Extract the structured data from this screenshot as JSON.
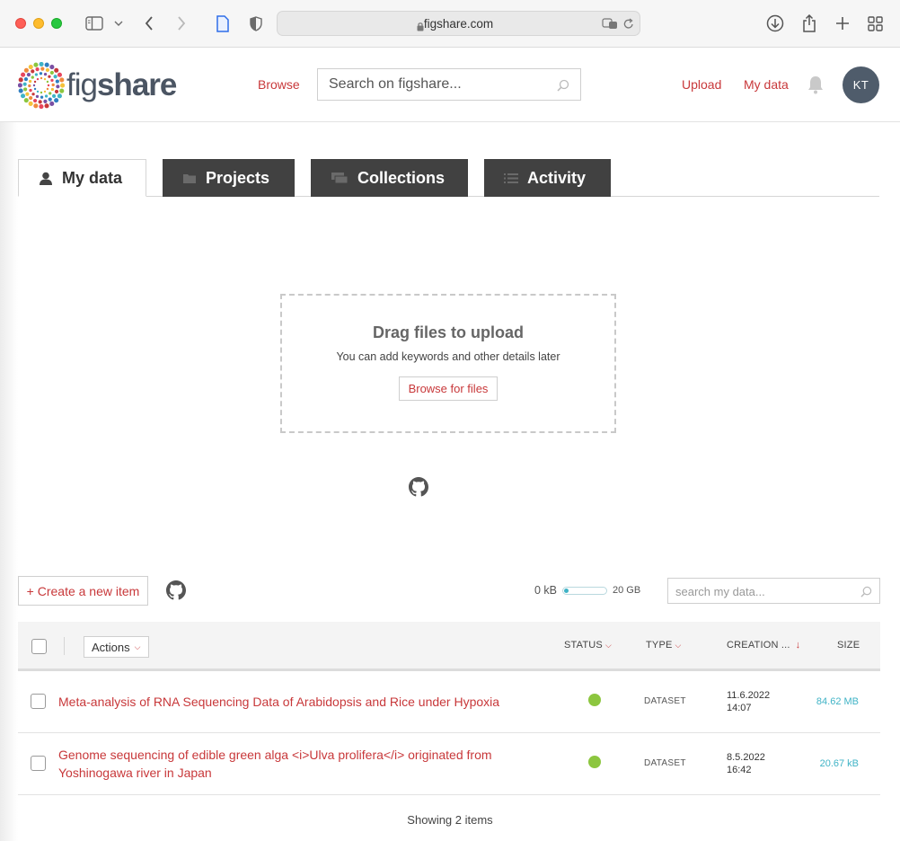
{
  "browser": {
    "url_host": "figshare.com"
  },
  "header": {
    "logo_fig": "fig",
    "logo_share": "share",
    "browse_label": "Browse",
    "search_placeholder": "Search on figshare...",
    "upload_label": "Upload",
    "mydata_label": "My data",
    "avatar_initials": "KT"
  },
  "tabs": [
    {
      "label": "My data",
      "icon": "user-icon",
      "active": true
    },
    {
      "label": "Projects",
      "icon": "folder-icon",
      "active": false
    },
    {
      "label": "Collections",
      "icon": "collections-icon",
      "active": false
    },
    {
      "label": "Activity",
      "icon": "list-icon",
      "active": false
    }
  ],
  "dropzone": {
    "title": "Drag files to upload",
    "subtitle": "You can add keywords and other details later",
    "button_label": "Browse for files"
  },
  "toolbar": {
    "create_label": "+ Create a new item",
    "storage_used": "0 kB",
    "storage_total": "20 GB",
    "storage_fraction": 0.0,
    "search_placeholder": "search my data..."
  },
  "table": {
    "actions_label": "Actions",
    "columns": {
      "status": "STATUS",
      "type": "TYPE",
      "creation": "CREATION ...",
      "size": "SIZE"
    },
    "rows": [
      {
        "title": "Meta-analysis of RNA Sequencing Data of Arabidopsis and Rice under Hypoxia",
        "status_color": "#8cc63f",
        "type": "DATASET",
        "date": "11.6.2022",
        "time": "14:07",
        "size": "84.62 MB"
      },
      {
        "title": "Genome sequencing of edible green alga <i>Ulva prolifera</i> originated from Yoshinogawa river in Japan",
        "status_color": "#8cc63f",
        "type": "DATASET",
        "date": "8.5.2022",
        "time": "16:42",
        "size": "20.67 kB"
      }
    ]
  },
  "footer": {
    "showing": "Showing 2 items"
  },
  "colors": {
    "accent": "#c8383a",
    "tab_dark": "#414141",
    "status_ok": "#8cc63f",
    "size_teal": "#3fb3c6"
  }
}
